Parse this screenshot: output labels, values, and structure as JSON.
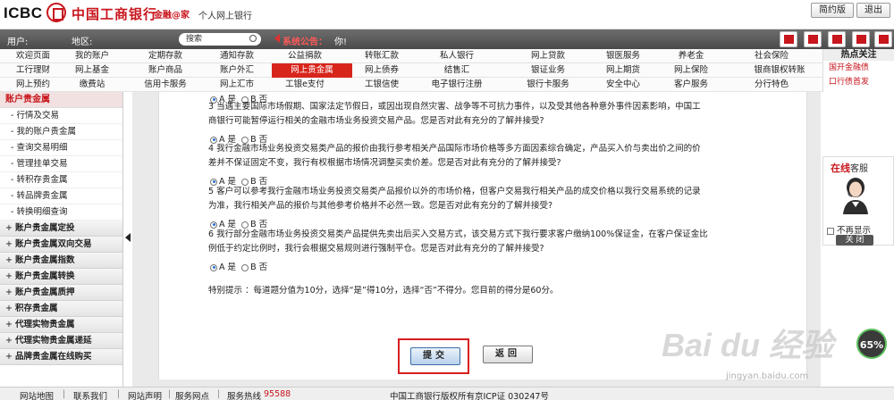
{
  "header": {
    "logo_en": "ICBC",
    "logo_cn": "中国工商银行",
    "slogan": "金融@家",
    "subtitle": "个人网上银行",
    "simple_btn": "简约版",
    "logout_btn": "退出"
  },
  "userbar": {
    "user_label": "用户:",
    "region_label": "地区:",
    "search_placeholder": "搜索",
    "notice_label": "系统公告：",
    "notice_text": "你!"
  },
  "nav": {
    "row1": [
      "欢迎页面",
      "我的账户",
      "定期存款",
      "通知存款",
      "公益捐款",
      "转账汇款",
      "私人银行",
      "网上贷款",
      "银医服务",
      "养老金",
      "社会保险"
    ],
    "row2": [
      "工行理财",
      "网上基金",
      "账户商品",
      "账户外汇",
      "网上贵金属",
      "网上债券",
      "结售汇",
      "银证业务",
      "网上期货",
      "网上保险",
      "银商银权转账"
    ],
    "row3": [
      "网上预约",
      "缴费站",
      "信用卡服务",
      "网上汇市",
      "工银e支付",
      "工银信使",
      "电子银行注册",
      "银行卡服务",
      "安全中心",
      "客户服务",
      "分行特色"
    ],
    "active": "网上贵金属"
  },
  "hot": {
    "title": "热点关注",
    "items": [
      "国开金融债",
      "口行债首发"
    ]
  },
  "sidebar": {
    "head": "账户贵金属",
    "subs": [
      "行情及交易",
      "我的账户贵金属",
      "查询交易明细",
      "管理挂单交易",
      "转积存贵金属",
      "转品牌贵金属",
      "转换明细查询"
    ],
    "cats": [
      "账户贵金属定投",
      "账户贵金属双向交易",
      "账户贵金属指数",
      "账户贵金属转换",
      "账户贵金属质押",
      "积存贵金属",
      "代理实物贵金属",
      "代理实物贵金属递延",
      "品牌贵金属在线购买"
    ]
  },
  "questions": {
    "yes_label": "是",
    "no_label": "否",
    "opt_a": "A",
    "opt_b": "B",
    "q3": "3 当遇主要国际市场假期、国家法定节假日，或因出现自然灾害、战争等不可抗力事件，以及受其他各种意外事件因素影响，中国工商银行可能暂停运行相关的金融市场业务投资交易产品。您是否对此有充分的了解并接受?",
    "q4": "4 我行金融市场业务投资交易类产品的报价由我行参考相关产品国际市场价格等多方面因素综合确定，产品买入价与卖出价之间的价差并不保证固定不变，我行有权根据市场情况调整买卖价差。您是否对此有充分的了解并接受?",
    "q5": "5 客户可以参考我行金融市场业务投资交易类产品报价以外的市场价格，但客户交易我行相关产品的成交价格以我行交易系统的记录为准，我行相关产品的报价与其他参考价格并不必然一致。您是否对此有充分的了解并接受?",
    "q6": "6 我行部分金融市场业务投资交易类产品提供先卖出后买入交易方式，该交易方式下我行要求客户缴纳100%保证金，在客户保证金比例低于约定比例时，我行会根据交易规则进行强制平仓。您是否对此有充分的了解并接受?",
    "tip": "特别提示 ：每道题分值为10分，选择“是”得10分，选择“否”不得分。您目前的得分是60分。"
  },
  "actions": {
    "submit": "提交",
    "back": "返回"
  },
  "service": {
    "title_red": "在线",
    "title_rest": "客服",
    "hide_label": "不再显示",
    "close_label": "关 闭"
  },
  "footer": {
    "links": [
      "网站地图",
      "联系我们",
      "网站声明",
      "服务网点"
    ],
    "hotline_label": "服务热线",
    "hotline": "95588",
    "copyright": "中国工商银行版权所有",
    "icp": "京ICP证 030247号"
  },
  "watermark": {
    "main": "Bai du 经验",
    "sub": "jingyan.baidu.com",
    "gauge": "65%"
  },
  "colors": {
    "brand_red": "#c8161d",
    "active_nav": "#d8251c",
    "highlight_border": "#d81e1e"
  }
}
